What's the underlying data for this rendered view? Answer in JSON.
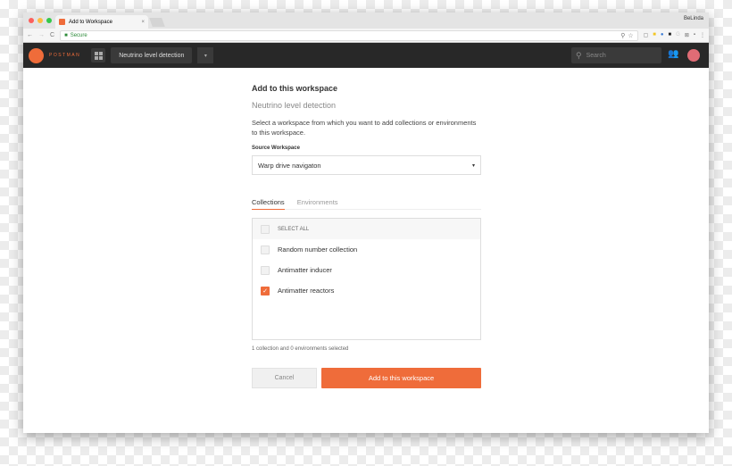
{
  "browser": {
    "tab_title": "Add to Workspace",
    "tab_close": "×",
    "user": "BeLinda",
    "secure_label": "Secure",
    "back": "←",
    "forward": "→",
    "reload": "C"
  },
  "header": {
    "brand": "POSTMAN",
    "workspace": "Neutrino level detection",
    "dropdown": "▾",
    "search_placeholder": "Search",
    "team_icon": "people-icon"
  },
  "main": {
    "title": "Add to this workspace",
    "subtitle": "Neutrino level detection",
    "description": "Select a workspace from which you want to add collections or environments to this workspace.",
    "source_label": "Source Workspace",
    "source_value": "Warp drive navigaton",
    "tabs": [
      {
        "label": "Collections",
        "active": true
      },
      {
        "label": "Environments",
        "active": false
      }
    ],
    "select_all": "SELECT ALL",
    "items": [
      {
        "label": "Random number collection",
        "checked": false
      },
      {
        "label": "Antimatter inducer",
        "checked": false
      },
      {
        "label": "Antimatter reactors",
        "checked": true
      }
    ],
    "count_text": "1 collection and 0 environments selected",
    "cancel": "Cancel",
    "submit": "Add to this workspace"
  },
  "colors": {
    "accent": "#ef6c3a",
    "header_bg": "#282828"
  }
}
